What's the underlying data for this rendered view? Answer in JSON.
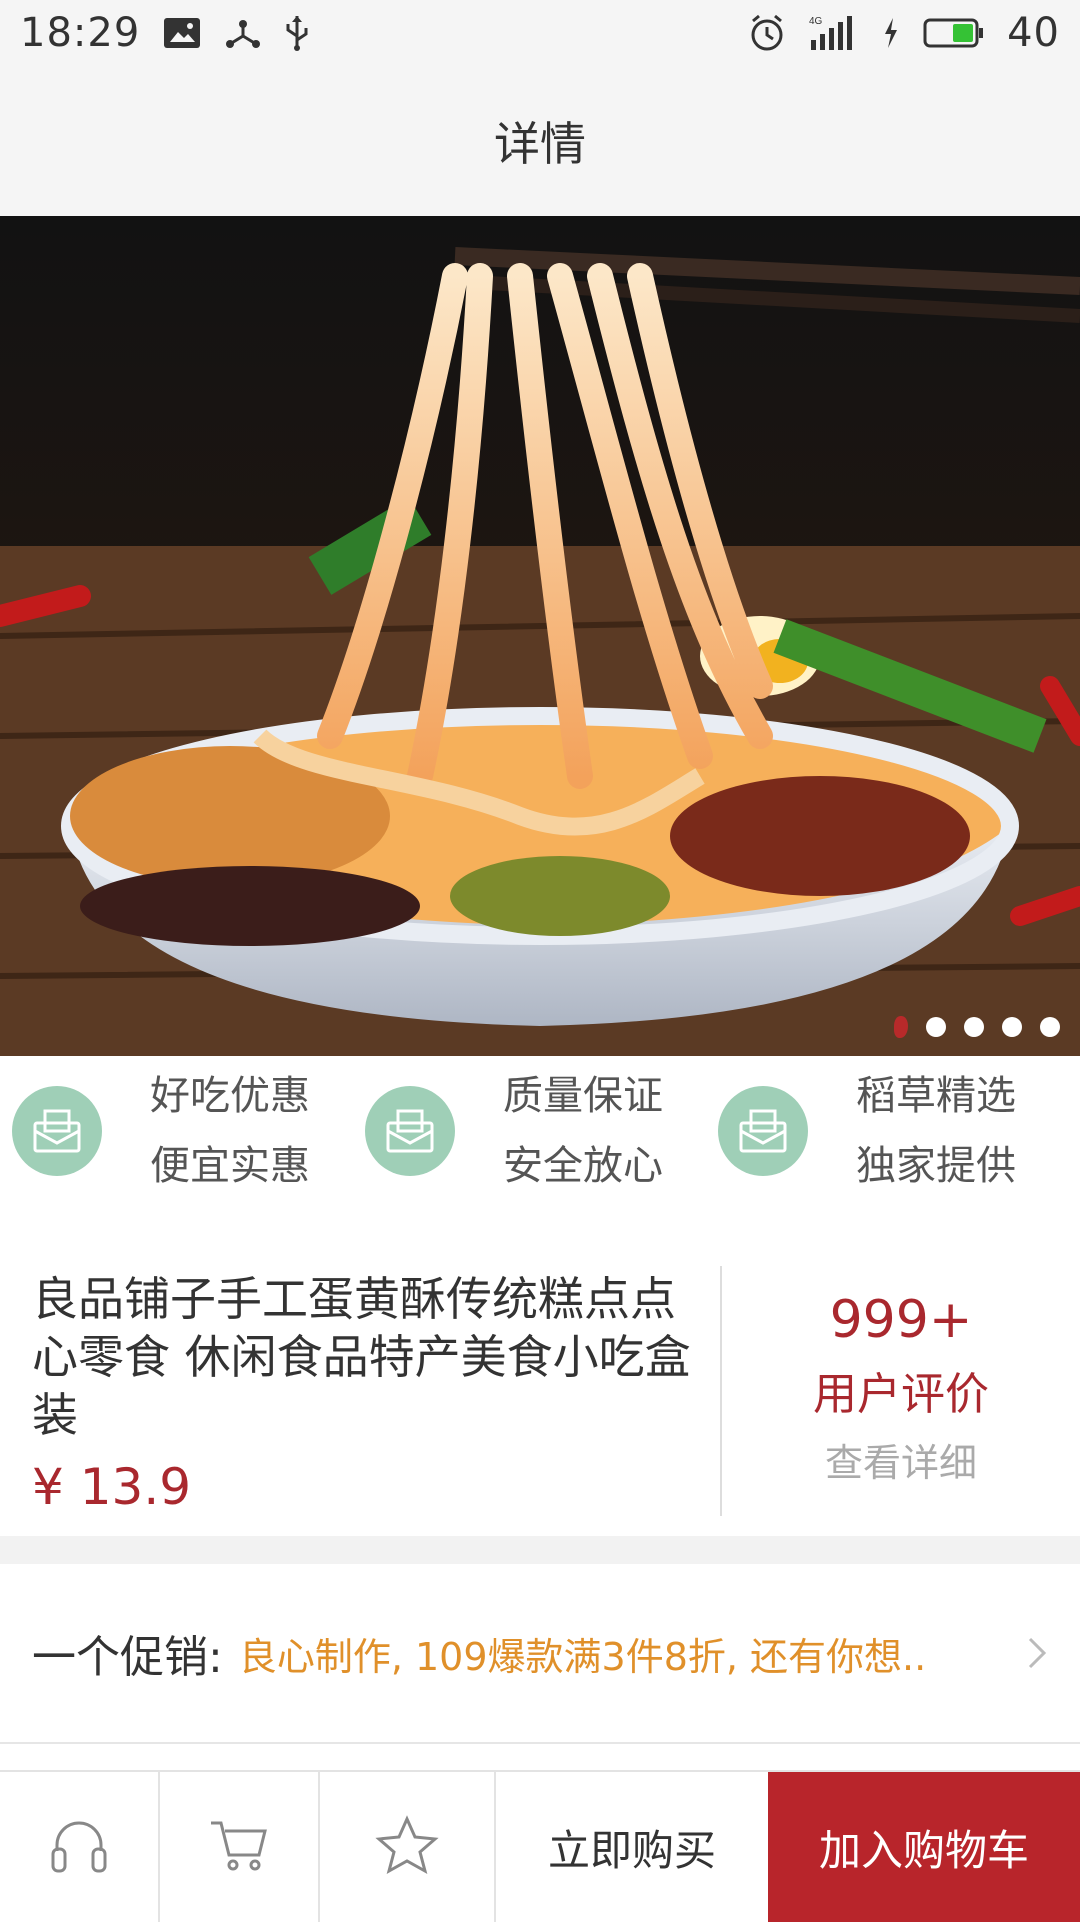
{
  "status_bar": {
    "time": "18:29",
    "battery": "40",
    "network": "4G"
  },
  "header": {
    "title": "详情"
  },
  "hero": {
    "image_icon": "food-photo-noodles",
    "slide_count": 5,
    "active_slide": 1
  },
  "features": [
    {
      "line1": "好吃优惠",
      "line2": "便宜实惠",
      "icon": "envelope-icon"
    },
    {
      "line1": "质量保证",
      "line2": "安全放心",
      "icon": "envelope-icon"
    },
    {
      "line1": "稻草精选",
      "line2": "独家提供",
      "icon": "envelope-icon"
    }
  ],
  "product": {
    "title": "良品铺子手工蛋黄酥传统糕点点心零食 休闲食品特产美食小吃盒装",
    "price": "¥ 13.9",
    "review_count": "999+",
    "review_label": "用户评价",
    "review_link": "查看详细"
  },
  "promo": {
    "label": "一个促销:",
    "text": "良心制作, 109爆款满3件8折, 还有你想..",
    "text_color": "#e0902a"
  },
  "bottom_bar": {
    "buy_now": "立即购买",
    "add_to_cart": "加入购物车",
    "accent": "#b8252b"
  }
}
